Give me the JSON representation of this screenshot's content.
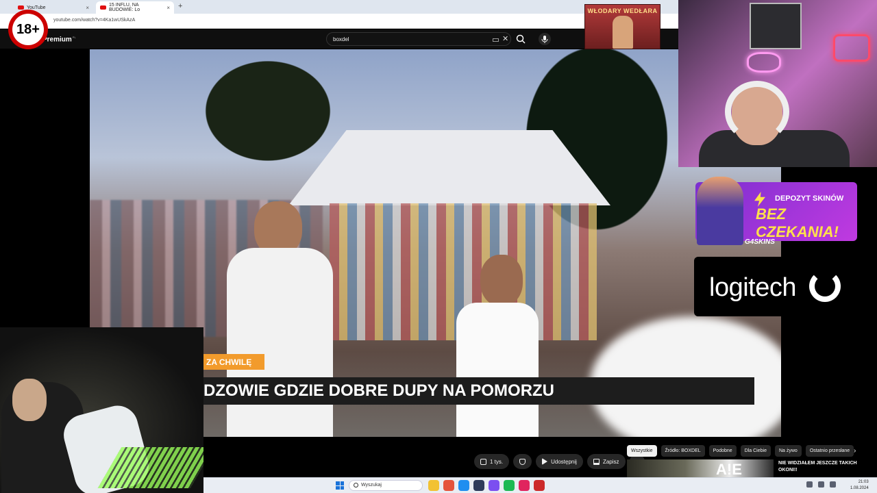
{
  "browser": {
    "tabs": [
      {
        "label": "YouTube",
        "active": false
      },
      {
        "label": "15 INFLU, NA BUDOWIE: Lo",
        "active": true
      }
    ],
    "new_tab_symbol": "+",
    "url": "youtube.com/watch?v=4Ka1wUSkAzA"
  },
  "youtube": {
    "brand": "Premium",
    "brand_region": "PL",
    "search_query": "boxdel",
    "icons": [
      "keyboard-icon",
      "clear-icon",
      "search-icon",
      "mic-icon"
    ]
  },
  "overlay": {
    "age_badge": "18+",
    "banner_text": "WŁODARY WEDŁARA",
    "caption_tag": "ZA CHWILĘ",
    "caption": "DZOWIE GDZIE DOBRE DUPY NA POMORZU"
  },
  "ads": {
    "g4skins": {
      "line1": "DEPOZYT SKINÓW",
      "line2": "BEZ CZEKANIA!",
      "brand": "G4SKINS"
    },
    "logitech": {
      "text": "logitech"
    }
  },
  "video_actions": {
    "like_count": "1 tys.",
    "share": "Udostępnij",
    "save": "Zapisz",
    "more": "⋯"
  },
  "chips": [
    "Wszystkie",
    "Źródło: BOXDEL",
    "Podobne",
    "Dla Ciebie",
    "Na żywo",
    "Ostatnio przesłane"
  ],
  "chips_active_index": 0,
  "chips_next": "›",
  "suggestion": {
    "title": "NIE WIDZIAŁEM JESZCZE TAKICH OKONI!!",
    "thumb_text": "A!E"
  },
  "taskbar": {
    "search_placeholder": "Wyszukaj",
    "time": "21:03",
    "date": "1.08.2024",
    "app_colors": [
      "#f2c233",
      "#e5533c",
      "#1f8ef0",
      "#2e3b5b",
      "#7b4ff0",
      "#1db954",
      "#e0245e",
      "#cc2a2a"
    ]
  },
  "colors": {
    "caption_tag_bg": "#f29b2c",
    "caption_bg": "#1d1d1d",
    "badge_red": "#cc0000"
  }
}
